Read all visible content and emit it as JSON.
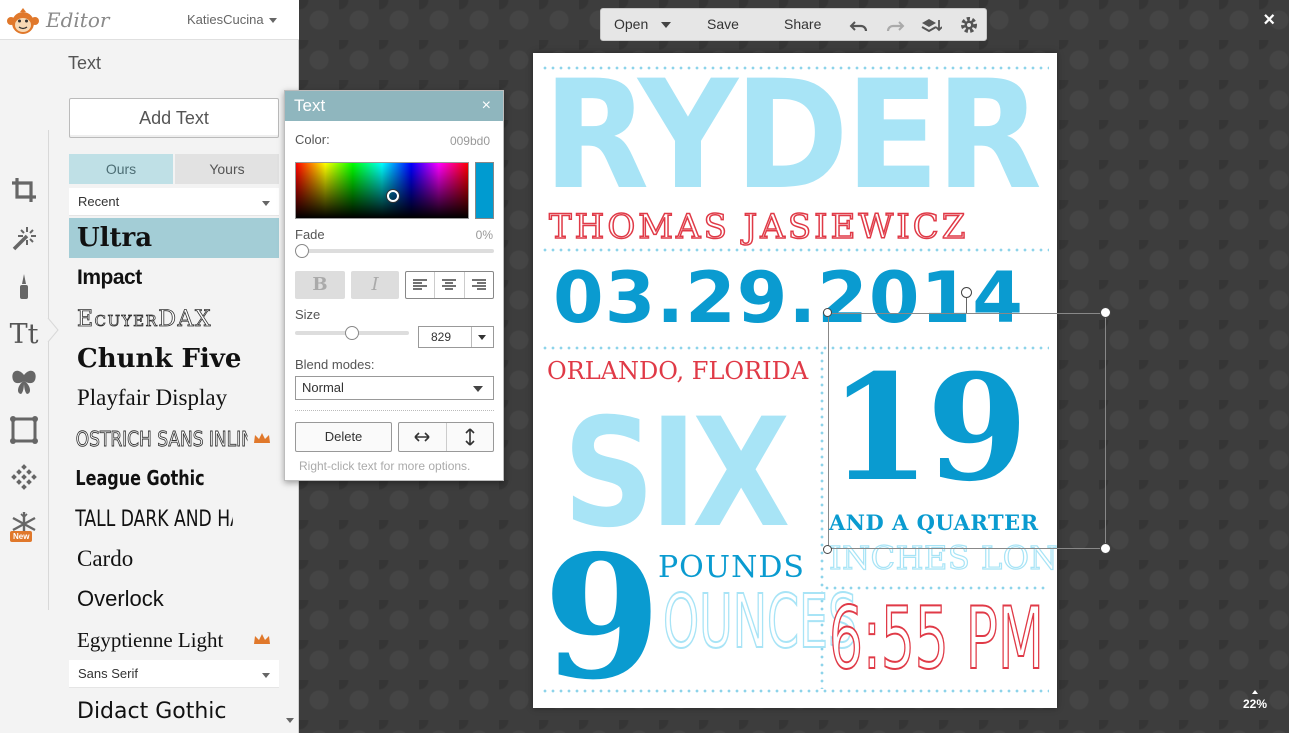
{
  "app": {
    "logo_text": "Editor",
    "user": "KatiesCucina"
  },
  "panel": {
    "title": "Text",
    "add_text_label": "Add Text",
    "tabs": [
      {
        "label": "Ours",
        "selected": true
      },
      {
        "label": "Yours",
        "selected": false
      }
    ],
    "category_select": "Recent",
    "fonts": [
      {
        "label": "Ultra",
        "selected": true,
        "premium": false
      },
      {
        "label": "Impact",
        "premium": false
      },
      {
        "label": "EcuyerDAX",
        "premium": false
      },
      {
        "label": "Chunk Five",
        "premium": false
      },
      {
        "label": "Playfair Display",
        "premium": false
      },
      {
        "label": "OSTRICH SANS INLINE",
        "premium": true
      },
      {
        "label": "League Gothic",
        "premium": false
      },
      {
        "label": "TALL DARK AND HANDSOME",
        "premium": false
      },
      {
        "label": "Cardo",
        "premium": false
      },
      {
        "label": "Overlock",
        "premium": false
      },
      {
        "label": "Egyptienne Light",
        "premium": true
      }
    ],
    "category_select_2": "Sans Serif",
    "fonts_2": [
      {
        "label": "Didact Gothic",
        "premium": false
      }
    ],
    "tools": [
      {
        "icon": "crop-icon"
      },
      {
        "icon": "magic-wand-icon"
      },
      {
        "icon": "brush-icon"
      },
      {
        "icon": "text-tool-icon",
        "label": "Tt",
        "active": true
      },
      {
        "icon": "butterfly-icon"
      },
      {
        "icon": "frame-icon"
      },
      {
        "icon": "texture-icon"
      },
      {
        "icon": "snowflake-icon",
        "badge": "New"
      }
    ]
  },
  "text_popup": {
    "title": "Text",
    "close": "×",
    "color_label": "Color:",
    "color_hex": "009bd0",
    "color_value": "#009bd0",
    "fade_label": "Fade",
    "fade_value": "0%",
    "fade_level": 0,
    "bold_label": "B",
    "italic_label": "I",
    "size_label": "Size",
    "size_value": "829",
    "blend_label": "Blend modes:",
    "blend_value": "Normal",
    "delete_label": "Delete",
    "hint": "Right-click text for more options."
  },
  "toolbar": {
    "open": "Open",
    "save": "Save",
    "share": "Share",
    "close": "×",
    "zoom": "22%"
  },
  "poster": {
    "name": "RYDER",
    "middle_name": "THOMAS JASIEWICZ",
    "date": "03.29.2014",
    "place": "ORLANDO, FLORIDA",
    "weight_lbs": "SIX",
    "weight_oz": "9",
    "pounds": "POUNDS",
    "ounces": "OUNCES",
    "length": "19",
    "length_fraction": "AND A QUARTER",
    "length_unit": "INCHES LONG",
    "time": "6:55 PM",
    "colors": {
      "light_blue": "#a8e4f6",
      "blue": "#0a9bd0",
      "red": "#e03a47"
    }
  }
}
